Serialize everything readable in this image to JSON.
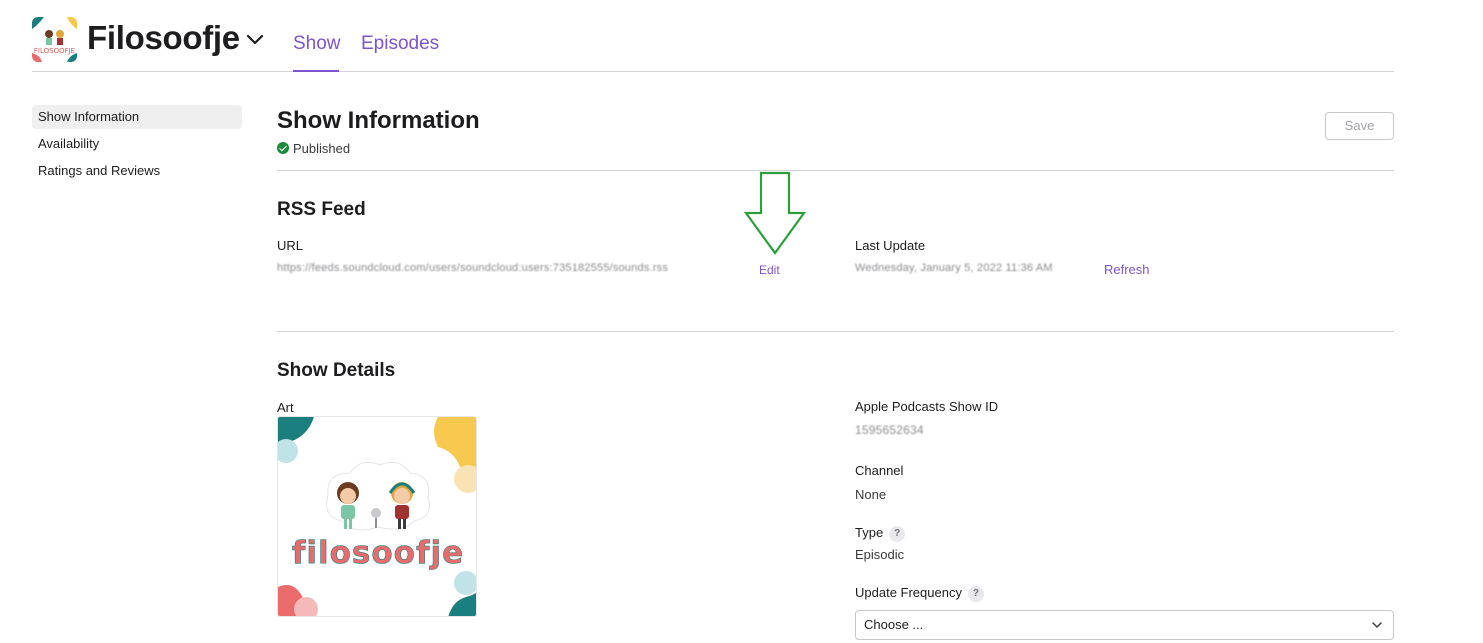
{
  "header": {
    "show_name": "Filosoofje",
    "logo_text": "FILOSOOFJE",
    "tabs": [
      {
        "label": "Show",
        "active": true
      },
      {
        "label": "Episodes",
        "active": false
      }
    ]
  },
  "sidebar": {
    "items": [
      {
        "label": "Show Information",
        "active": true
      },
      {
        "label": "Availability",
        "active": false
      },
      {
        "label": "Ratings and Reviews",
        "active": false
      }
    ]
  },
  "main": {
    "title": "Show Information",
    "status": "Published",
    "save_label": "Save",
    "rss": {
      "heading": "RSS Feed",
      "url_label": "URL",
      "url_value": "https://feeds.soundcloud.com/users/soundcloud:users:735182555/sounds.rss",
      "edit_label": "Edit",
      "last_update_label": "Last Update",
      "last_update_value": "Wednesday, January 5, 2022 11:36 AM",
      "refresh_label": "Refresh"
    },
    "details": {
      "heading": "Show Details",
      "art_label": "Art",
      "art_text": "filosoofje",
      "show_id_label": "Apple Podcasts Show ID",
      "show_id_value": "1595652634",
      "channel_label": "Channel",
      "channel_value": "None",
      "type_label": "Type",
      "type_value": "Episodic",
      "update_frequency_label": "Update Frequency",
      "update_frequency_placeholder": "Choose ...",
      "help_glyph": "?"
    }
  },
  "colors": {
    "accent": "#7d53d0",
    "published": "#1d8a3b",
    "annotation": "#2ba03a"
  }
}
